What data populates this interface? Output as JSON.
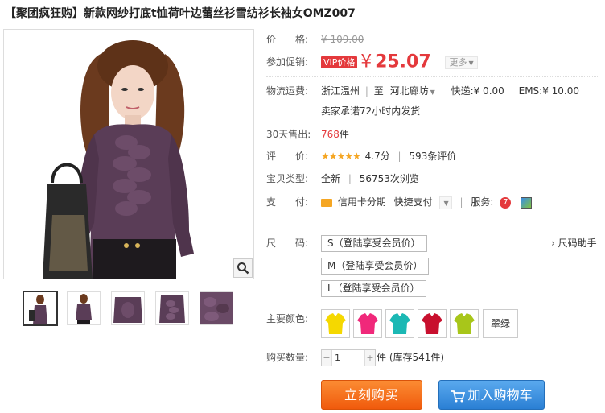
{
  "product": {
    "title": "【聚团疯狂购】新款网纱打底t恤荷叶边蕾丝衫雪纺衫长袖女OMZ007"
  },
  "gallery": {
    "thumbnail_count": 5
  },
  "price": {
    "label": "价　　格:",
    "original": "¥ 109.00"
  },
  "promo": {
    "label": "参加促销:",
    "badge": "VIP价格",
    "currency": "¥",
    "price": "25.07",
    "more": "更多"
  },
  "shipping": {
    "label": "物流运费:",
    "from": "浙江温州",
    "to_prefix": "至",
    "to": "河北廊坊",
    "express": "快递:¥ 0.00",
    "ems": "EMS:¥ 10.00",
    "promise": "卖家承诺72小时内发货"
  },
  "sales": {
    "label": "30天售出:",
    "count": "768",
    "unit": "件"
  },
  "rating": {
    "label": "评　　价:",
    "stars": "★★★★★",
    "score": "4.7分",
    "reviews": "593条评价",
    "value": 4.7
  },
  "type": {
    "label": "宝贝类型:",
    "condition": "全新",
    "views": "56753次浏览"
  },
  "payment": {
    "label": "支　　付:",
    "credit": "信用卡分期",
    "quick": "快捷支付",
    "service_label": "服务:"
  },
  "size": {
    "label": "尺　　码:",
    "options": [
      "S（登陆享受会员价）",
      "M（登陆享受会员价）",
      "L（登陆享受会员价）"
    ],
    "helper": "尺码助手"
  },
  "color": {
    "label": "主要颜色:",
    "swatches": [
      "#f5d800",
      "#f0287a",
      "#1bb8b4",
      "#c8102e",
      "#a8c61a"
    ],
    "text_option": "翠绿"
  },
  "quantity": {
    "label": "购买数量:",
    "value": "1",
    "stock": "件 (库存541件)"
  },
  "actions": {
    "buy": "立刻购买",
    "cart": "加入购物车"
  },
  "colors": {
    "accent": "#e4393c",
    "buy": "#f05a0c",
    "cart": "#2a7fd4",
    "garment": "#5a3d57"
  }
}
